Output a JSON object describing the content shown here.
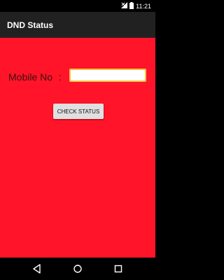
{
  "status_bar": {
    "time": "11:21",
    "icons": [
      "signal-icon",
      "battery-icon"
    ]
  },
  "app_bar": {
    "title": "DND Status"
  },
  "form": {
    "mobile_label": "Mobile No",
    "colon": ":",
    "mobile_value": "",
    "mobile_placeholder": ""
  },
  "actions": {
    "check_status_label": "CHECK STATUS"
  },
  "colors": {
    "content_background": "#ff1429",
    "app_bar_background": "#212121",
    "input_border": "#f5c341",
    "button_background": "#e0e0e0"
  },
  "nav_bar": {
    "icons": [
      "back-icon",
      "home-icon",
      "recents-icon"
    ]
  }
}
